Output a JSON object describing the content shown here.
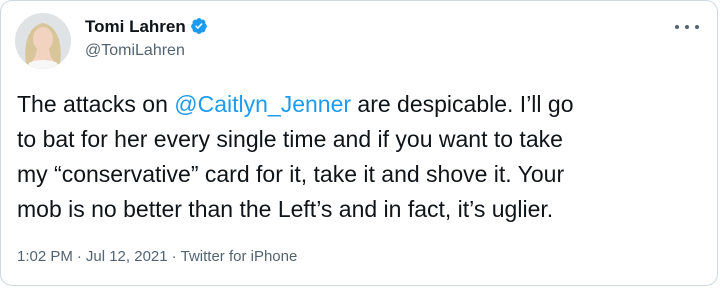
{
  "author": {
    "display_name": "Tomi Lahren",
    "handle": "@TomiLahren",
    "verified": true
  },
  "tweet": {
    "line1_before": "The attacks on ",
    "mention": "@Caitlyn_Jenner",
    "line1_after": " are despicable. I’ll go",
    "line2": "to bat for her every single time and if you want to take",
    "line3": "my “conservative” card for it, take it and shove it. Your",
    "line4": "mob is no better than the Left’s and in fact, it’s uglier."
  },
  "meta": {
    "time": "1:02 PM",
    "separator": "·",
    "date": "Jul 12, 2021",
    "source": "Twitter for iPhone"
  },
  "icons": {
    "verified": "verified-badge-icon",
    "more": "more-horizontal-icon"
  },
  "colors": {
    "accent": "#1d9bf0",
    "text": "#0f1419",
    "muted": "#536471",
    "border": "#cfd9de"
  }
}
